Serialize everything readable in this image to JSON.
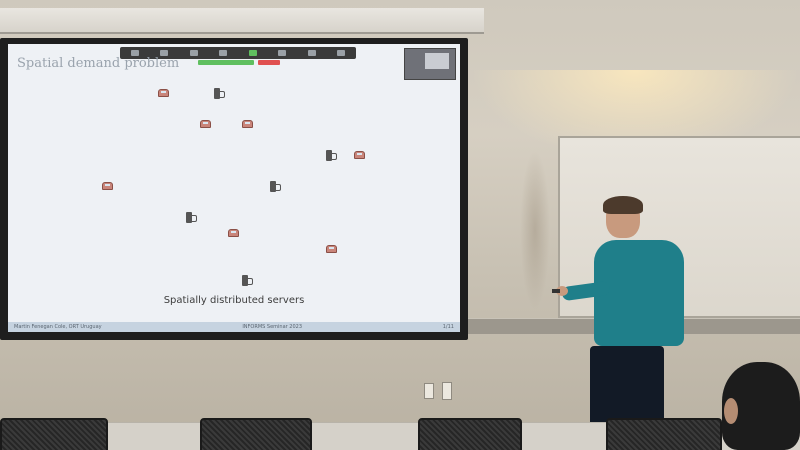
{
  "slide": {
    "title": "Spatial demand problem",
    "caption": "Spatially distributed servers",
    "footer_left": "Martin Fenegan Cole, ORT Uruguay",
    "footer_center": "INFORMS Seminar 2023",
    "footer_right": "1/11"
  },
  "icons": {
    "vehicle": "car-icon",
    "server": "ev-charging-station-icon"
  },
  "colors": {
    "slide_background": "#eef1f5",
    "sweater": "#1f7f8a",
    "car": "#c9857a"
  }
}
